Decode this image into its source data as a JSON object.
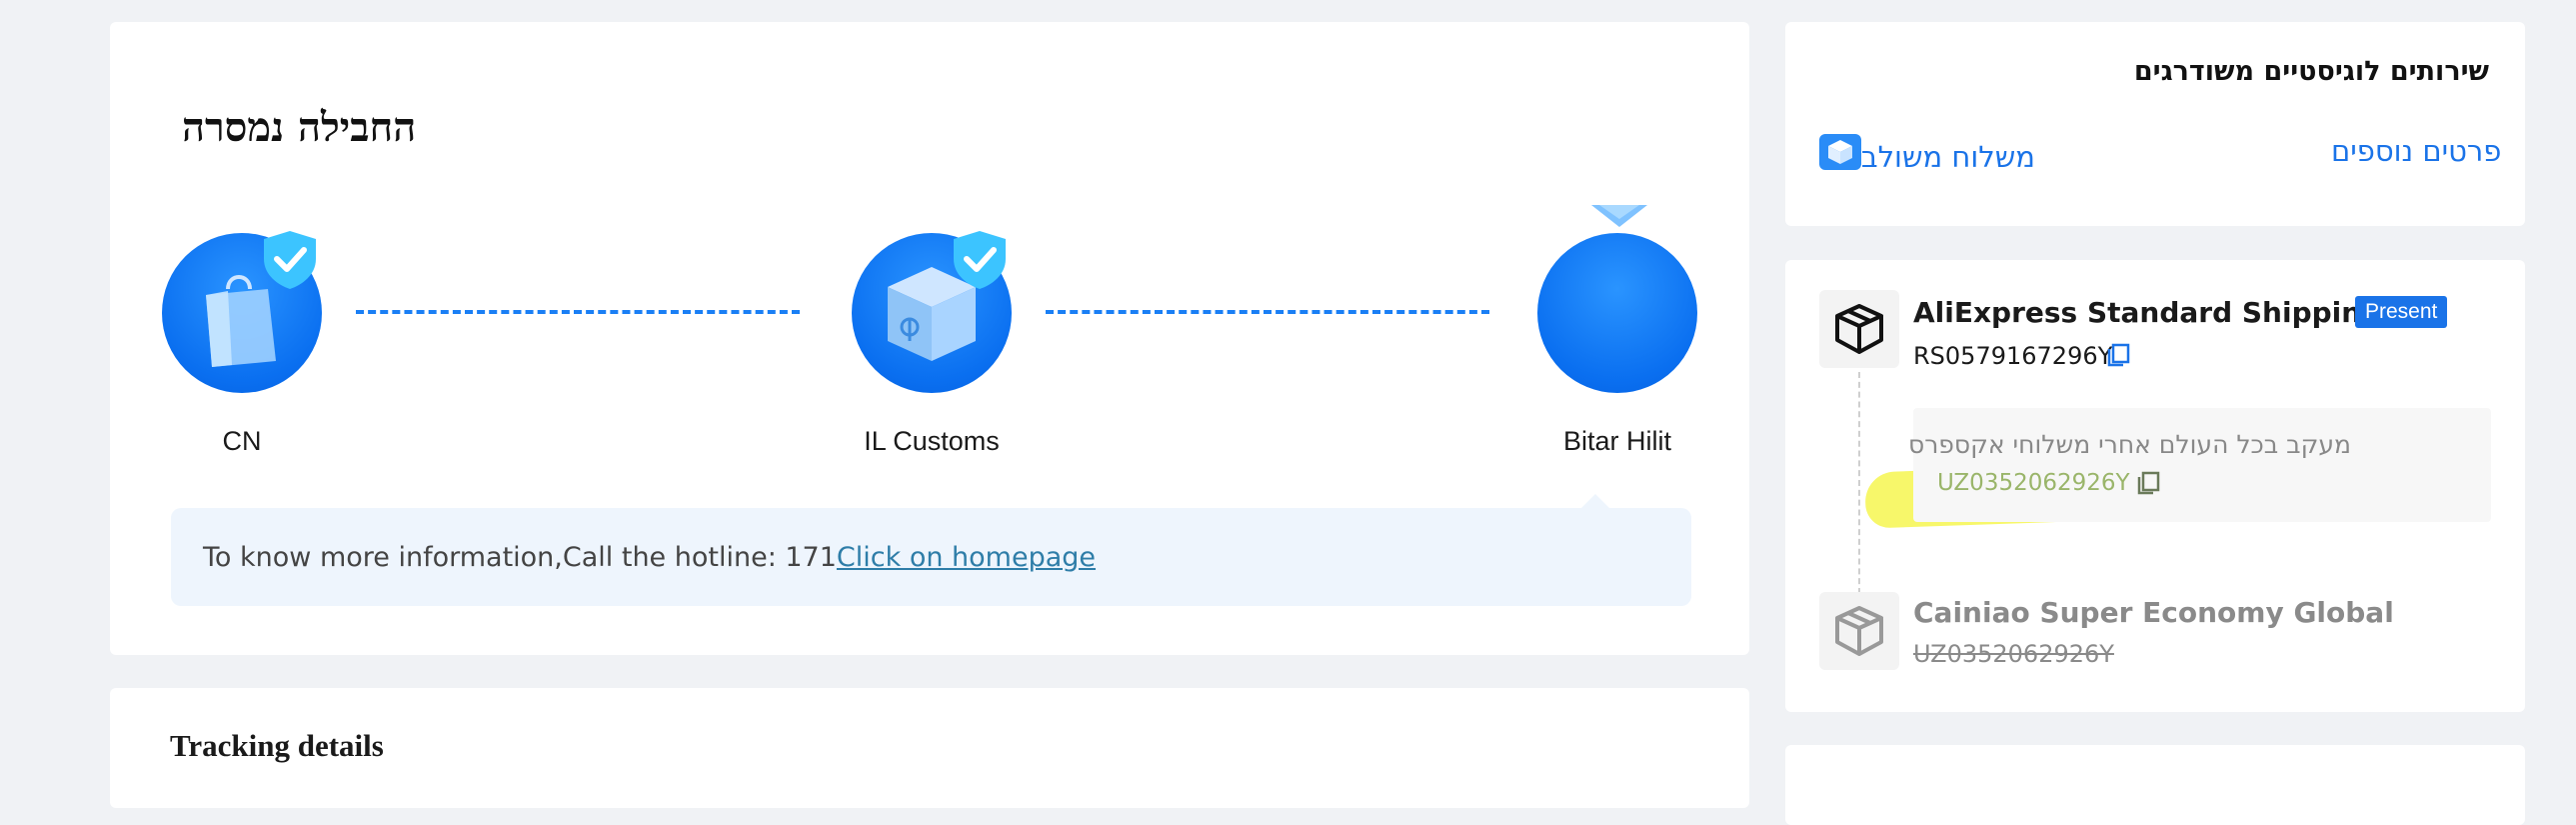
{
  "status": {
    "title": "החבילה נמסרה",
    "nodes": [
      {
        "label": "CN"
      },
      {
        "label": "IL Customs"
      },
      {
        "label": "Bitar Hilit"
      }
    ],
    "banner": {
      "text": "To know more information,Call the hotline: 171",
      "link": "Click on homepage"
    }
  },
  "tracking_details": {
    "title": "Tracking details"
  },
  "services": {
    "title": "שירותים לוגיסטיים משודרגים",
    "more_details": "פרטים נוספים",
    "combined_shipping": "משלוח משולב"
  },
  "carriers": [
    {
      "name": "AliExpress Standard Shipping",
      "badge": "Present",
      "tracking": "RS0579167296Y",
      "sub": {
        "text": "מעקב בכל העולם אחרי משלוחי אקספרס",
        "tracking": "UZ0352062926Y"
      }
    },
    {
      "name": "Cainiao Super Economy Global",
      "tracking": "UZ0352062926Y"
    }
  ],
  "colors": {
    "accent": "#1a73e8",
    "progress": "#1a7ff5",
    "highlight": "#f7f76a",
    "banner_bg": "#eef5fd"
  }
}
